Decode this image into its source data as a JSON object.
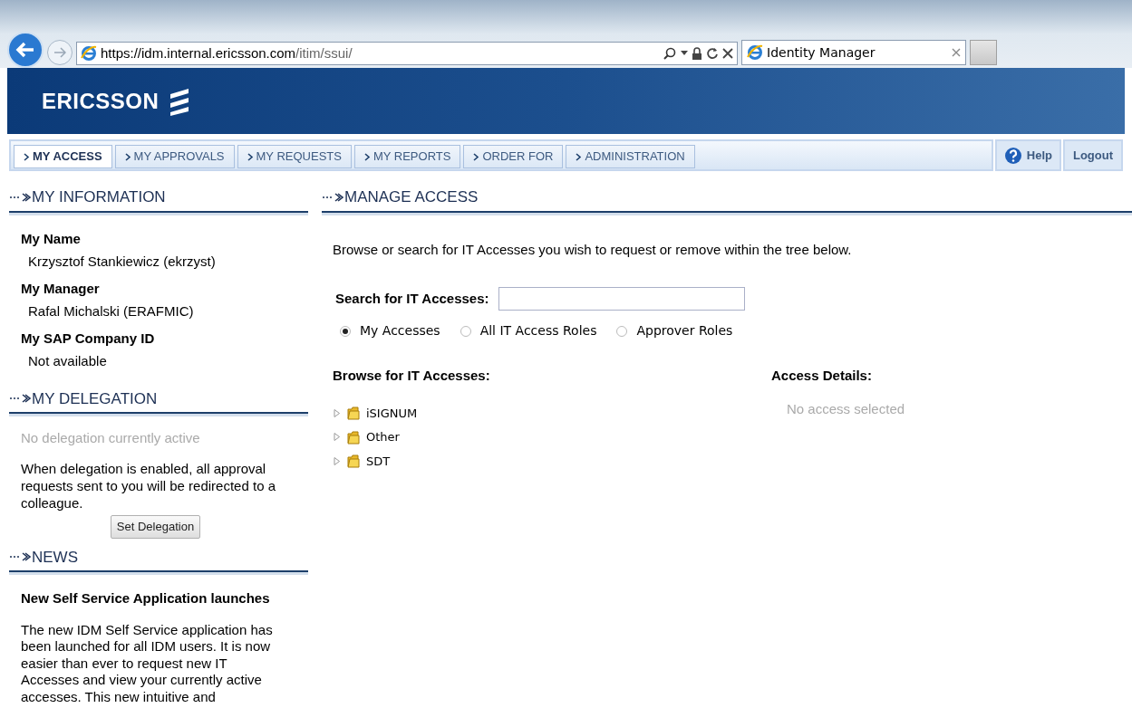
{
  "browser": {
    "url_host": "https://idm.internal.ericsson.com",
    "url_path": "/itim/ssui/",
    "tab_title": "Identity Manager"
  },
  "header": {
    "logo_text": "ERICSSON"
  },
  "nav_tabs": [
    {
      "label": "MY ACCESS",
      "selected": true
    },
    {
      "label": "MY APPROVALS",
      "selected": false
    },
    {
      "label": "MY REQUESTS",
      "selected": false
    },
    {
      "label": "MY REPORTS",
      "selected": false
    },
    {
      "label": "ORDER FOR",
      "selected": false
    },
    {
      "label": "ADMINISTRATION",
      "selected": false
    }
  ],
  "nav_actions": {
    "help": "Help",
    "logout": "Logout"
  },
  "my_information": {
    "title": "MY INFORMATION",
    "fields": [
      {
        "label": "My Name",
        "value": "Krzysztof Stankiewicz (ekrzyst)"
      },
      {
        "label": "My Manager",
        "value": "Rafal Michalski (ERAFMIC)"
      },
      {
        "label": "My SAP Company ID",
        "value": "Not available"
      }
    ]
  },
  "my_delegation": {
    "title": "MY DELEGATION",
    "status": "No delegation currently active",
    "description": "When delegation is enabled, all approval requests sent to you will be redirected to a colleague.",
    "button": "Set Delegation"
  },
  "news": {
    "title": "NEWS",
    "headline": "New Self Service Application launches",
    "body": "The new IDM Self Service application has been launched for all IDM users. It is now easier than ever to request new IT Accesses and view your currently active accesses. This new intuitive and"
  },
  "manage_access": {
    "title": "MANAGE ACCESS",
    "intro": "Browse or search for IT Accesses you wish to request or remove within the tree below.",
    "search_label": "Search for IT Accesses:",
    "scopes": [
      {
        "label": "My Accesses",
        "selected": true
      },
      {
        "label": "All IT Access Roles",
        "selected": false
      },
      {
        "label": "Approver Roles",
        "selected": false
      }
    ],
    "browse_label": "Browse for IT Accesses:",
    "tree": [
      {
        "label": "iSIGNUM",
        "expanded": false
      },
      {
        "label": "Other",
        "expanded": false
      },
      {
        "label": "SDT",
        "expanded": false
      }
    ],
    "details_label": "Access Details:",
    "details_empty": "No access selected"
  }
}
